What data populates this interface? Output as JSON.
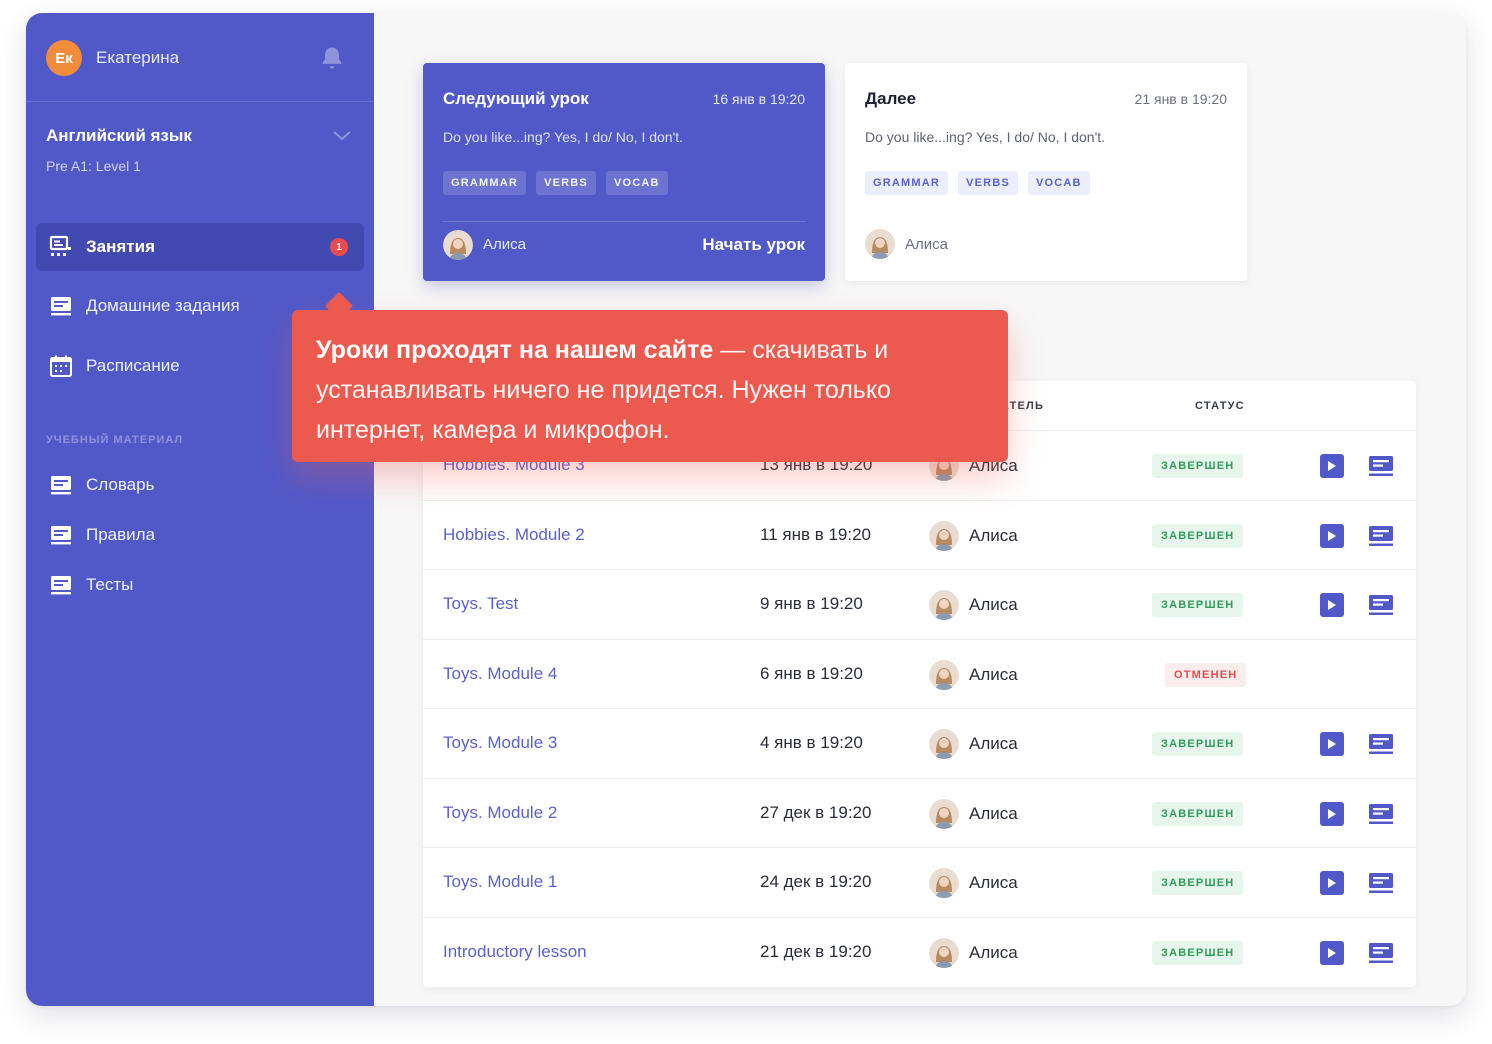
{
  "user": {
    "initials": "Ек",
    "name": "Екатерина"
  },
  "course": {
    "title": "Английский язык",
    "level": "Pre A1: Level 1"
  },
  "nav": {
    "lessons": {
      "label": "Занятия",
      "badge": "1"
    },
    "homework": {
      "label": "Домашние задания"
    },
    "schedule": {
      "label": "Расписание"
    },
    "section_label": "УЧЕБНЫЙ МАТЕРИАЛ",
    "dictionary": {
      "label": "Словарь"
    },
    "rules": {
      "label": "Правила"
    },
    "tests": {
      "label": "Тесты"
    }
  },
  "cards": {
    "next": {
      "title": "Следующий урок",
      "date": "16 янв в 19:20",
      "desc": "Do you like...ing? Yes, I do/ No, I don't.",
      "tags": [
        "GRAMMAR",
        "VERBS",
        "VOCAB"
      ],
      "teacher": "Алиса",
      "action": "Начать урок"
    },
    "later": {
      "title": "Далее",
      "date": "21 янв в 19:20",
      "desc": "Do you like...ing? Yes, I do/ No, I don't.",
      "tags": [
        "GRAMMAR",
        "VERBS",
        "VOCAB"
      ],
      "teacher": "Алиса"
    }
  },
  "table": {
    "headers": {
      "teacher_partial": "АТЕЛЬ",
      "status": "СТАТУС"
    },
    "rows": [
      {
        "lesson": "Hobbies. Module 3",
        "date": "13 янв в 19:20",
        "teacher": "Алиса",
        "status": "ЗАВЕРШЕН"
      },
      {
        "lesson": "Hobbies. Module 2",
        "date": "11 янв в 19:20",
        "teacher": "Алиса",
        "status": "ЗАВЕРШЕН"
      },
      {
        "lesson": "Toys. Test",
        "date": "9 янв в 19:20",
        "teacher": "Алиса",
        "status": "ЗАВЕРШЕН"
      },
      {
        "lesson": "Toys. Module 4",
        "date": "6 янв в 19:20",
        "teacher": "Алиса",
        "status": "ОТМЕНЕН"
      },
      {
        "lesson": "Toys. Module 3",
        "date": "4 янв в 19:20",
        "teacher": "Алиса",
        "status": "ЗАВЕРШЕН"
      },
      {
        "lesson": "Toys. Module 2",
        "date": "27 дек в 19:20",
        "teacher": "Алиса",
        "status": "ЗАВЕРШЕН"
      },
      {
        "lesson": "Toys. Module 1",
        "date": "24 дек в 19:20",
        "teacher": "Алиса",
        "status": "ЗАВЕРШЕН"
      },
      {
        "lesson": "Introductory lesson",
        "date": "21 дек в 19:20",
        "teacher": "Алиса",
        "status": "ЗАВЕРШЕН"
      }
    ]
  },
  "tooltip": {
    "bold": "Уроки проходят на нашем сайте",
    "rest": " — скачивать и устанавливать ничего не придется. Нужен только интернет, камера и микрофон."
  },
  "colors": {
    "brand": "#5159c9",
    "accent": "#f08c3a",
    "tooltip": "#ec5a4f",
    "success": "#2e9d58",
    "danger": "#e04c4c"
  }
}
